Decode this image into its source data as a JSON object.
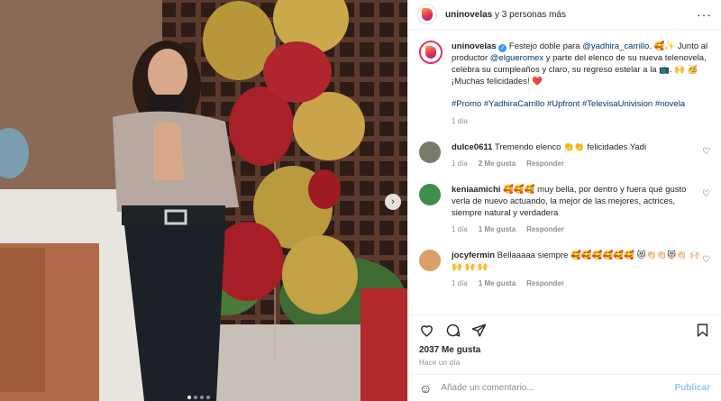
{
  "header": {
    "username": "uninovelas",
    "collab_text": " y 3 personas más",
    "more_icon": "more-horizontal-icon"
  },
  "caption": {
    "username": "uninovelas",
    "text_1": " Festejo doble para ",
    "mention_1": "@yadhira_carrillo",
    "text_2": ". 🥰✨ Junto al productor ",
    "mention_2": "@elgueromex",
    "text_3": " y parte del elenco de su nueva telenovela, celebra su cumpleaños y claro, su regreso estelar a la 📺. 🙌 🥳 ¡Muchas felicidades! ❤️",
    "hashtags": "#Promo #YadhiraCarrillo #Upfront #TelevisaUnivision #novela",
    "time": "1 día"
  },
  "comments": [
    {
      "username": "dulce0611",
      "text": " Tremendo elenco 👏👏 felicidades Yadi",
      "time": "1 día",
      "likes": "2 Me gusta",
      "reply": "Responder",
      "avatar_color": "#7a7a6a"
    },
    {
      "username": "keniaamichi",
      "text": " 🥰🥰🥰 muy bella, por dentro y fuera qué gusto verla de nuevo actuando, la mejor de las mejores, actrices, siempre natural y verdadera",
      "time": "1 día",
      "likes": "1 Me gusta",
      "reply": "Responder",
      "avatar_color": "#3f8f4a"
    },
    {
      "username": "jocyfermin",
      "text": " Bellaaaaa siempre 🥰🥰🥰🥰🥰🥰 😻👏🏻👏🏻😻👏🏻 🙌🏻 🙌 🙌 🙌",
      "time": "1 día",
      "likes": "1 Me gusta",
      "reply": "Responder",
      "avatar_color": "#d9a06a"
    }
  ],
  "actions": {
    "like_icon": "heart-icon",
    "comment_icon": "comment-icon",
    "share_icon": "share-icon",
    "save_icon": "bookmark-icon"
  },
  "likes": "2037 Me gusta",
  "posted_ago": "Hace un día",
  "add_comment": {
    "placeholder": "Añade un comentario...",
    "post_label": "Publicar",
    "emoji_icon": "smiley-icon"
  },
  "photo": {
    "next_icon": "chevron-right-icon",
    "carousel_dots": 4,
    "carousel_active": 1
  }
}
